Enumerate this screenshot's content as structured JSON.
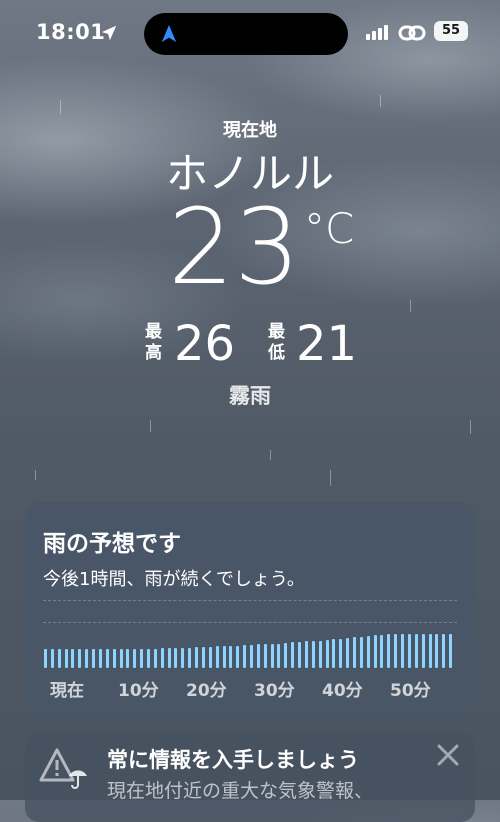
{
  "status_bar": {
    "time": "18:01",
    "battery": "55",
    "icons": [
      "location-arrow-icon",
      "navigation-arrow-icon",
      "cellular-signal-icon",
      "link-icon",
      "battery-icon"
    ]
  },
  "weather": {
    "location_label": "現在地",
    "city": "ホノルル",
    "temperature": "23",
    "unit": "°C",
    "high_label": "最高",
    "high": "26",
    "low_label": "最低",
    "low": "21",
    "condition": "霧雨"
  },
  "precip_card": {
    "title": "雨の予想です",
    "subtitle": "今後1時間、雨が続くでしょう。",
    "bar_color": "#8fd3ff",
    "labels": [
      "現在",
      "10分",
      "20分",
      "30分",
      "40分",
      "50分"
    ],
    "intensity": [
      0.55,
      0.55,
      0.55,
      0.55,
      0.55,
      0.55,
      0.55,
      0.55,
      0.55,
      0.55,
      0.56,
      0.56,
      0.56,
      0.56,
      0.57,
      0.57,
      0.57,
      0.58,
      0.58,
      0.58,
      0.6,
      0.6,
      0.62,
      0.62,
      0.62,
      0.64,
      0.64,
      0.66,
      0.66,
      0.68,
      0.68,
      0.7,
      0.7,
      0.72,
      0.72,
      0.74,
      0.76,
      0.76,
      0.78,
      0.8,
      0.8,
      0.82,
      0.84,
      0.86,
      0.88,
      0.9,
      0.92,
      0.94,
      0.96,
      0.98,
      1.0,
      1.0,
      1.0,
      1.0,
      1.0,
      1.0,
      1.0,
      1.0,
      1.0,
      1.0
    ]
  },
  "alert_card": {
    "title": "常に情報を入手しましょう",
    "text": "現在地付近の重大な気象警報、"
  }
}
